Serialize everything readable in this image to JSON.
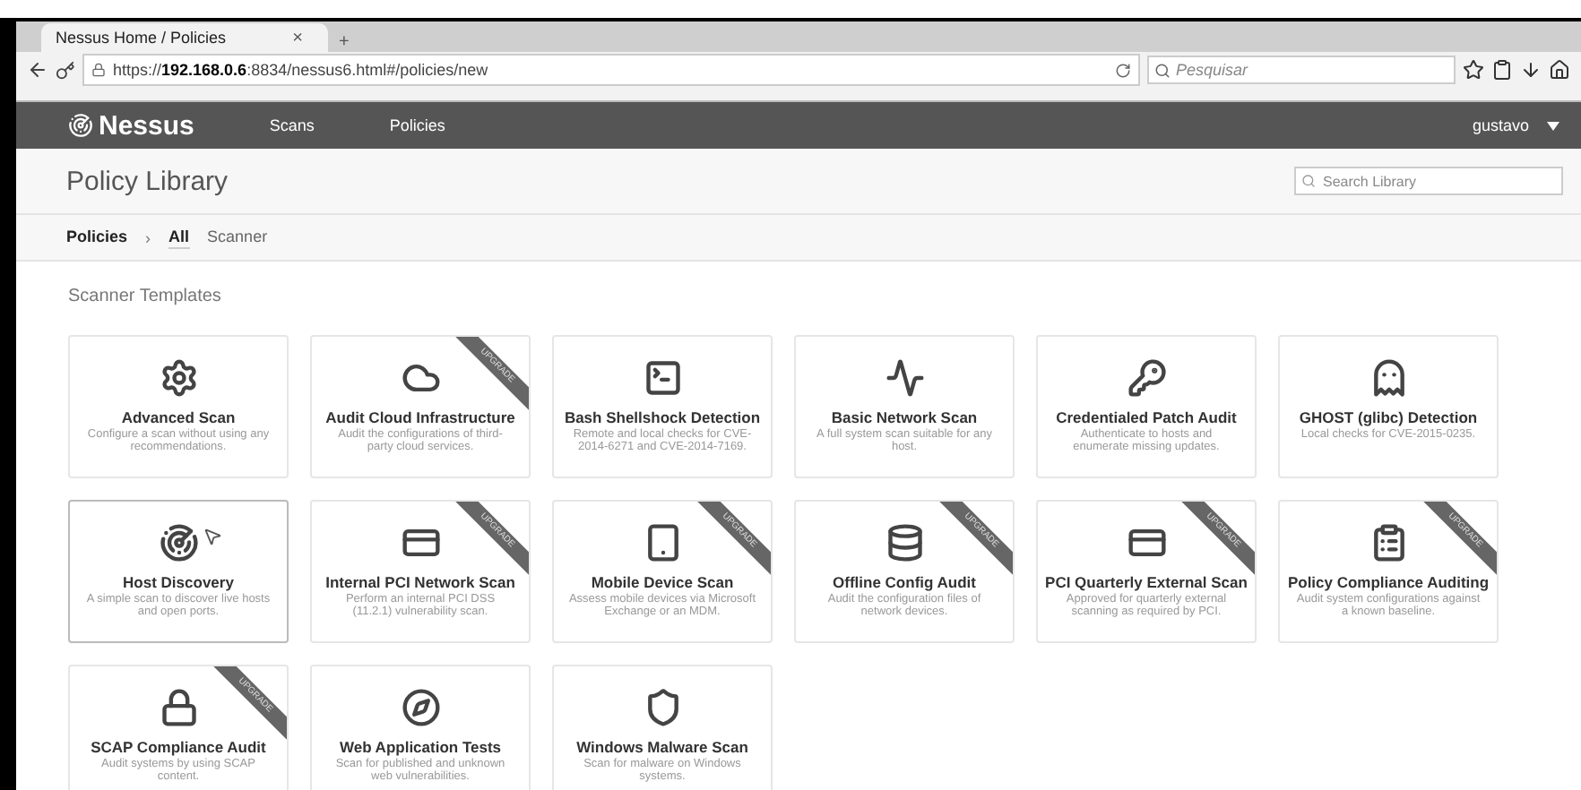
{
  "browser": {
    "tab": {
      "title": "Nessus Home / Policies",
      "close": "×",
      "new_tab": "+"
    },
    "url": "https://**192.168.0.6**:8834/nessus6.html#/policies/new",
    "search": {
      "placeholder": "Pesquisar"
    }
  },
  "nav": {
    "logo": "Nessus",
    "items": [
      {
        "label": "Scans"
      },
      {
        "label": "Policies"
      }
    ],
    "user": "gustavo"
  },
  "header": {
    "title": "Policy Library",
    "search": {
      "placeholder": "Search Library"
    }
  },
  "breadcrumb": {
    "items": [
      {
        "label": "Policies",
        "selected": false
      },
      {
        "label": "All",
        "selected": true
      },
      {
        "label": "Scanner",
        "selected": false
      }
    ],
    "separator": "›"
  },
  "section_title": "Scanner Templates",
  "templates": [
    {
      "title": "Advanced Scan",
      "description": "Configure a scan without using any recommendations."
    },
    {
      "title": "Audit Cloud Infrastructure",
      "description": "Audit the configurations of third-party cloud services.",
      "ribbon": "UPGRADE"
    },
    {
      "title": "Bash Shellshock Detection",
      "description": "Remote and local checks for CVE-2014-6271 and CVE-2014-7169."
    },
    {
      "title": "Basic Network Scan",
      "description": "A full system scan suitable for any host."
    },
    {
      "title": "Credentialed Patch Audit",
      "description": "Authenticate to hosts and enumerate missing updates."
    },
    {
      "title": "GHOST (glibc) Detection",
      "description": "Local checks for CVE-2015-0235."
    },
    {
      "title": "Host Discovery",
      "description": "A simple scan to discover live hosts and open ports.",
      "hovered": true
    },
    {
      "title": "Internal PCI Network Scan",
      "description": "Perform an internal PCI DSS (11.2.1) vulnerability scan.",
      "ribbon": "UPGRADE"
    },
    {
      "title": "Mobile Device Scan",
      "description": "Assess mobile devices via Microsoft Exchange or an MDM.",
      "ribbon": "UPGRADE"
    },
    {
      "title": "Offline Config Audit",
      "description": "Audit the configuration files of network devices.",
      "ribbon": "UPGRADE"
    },
    {
      "title": "PCI Quarterly External Scan",
      "description": "Approved for quarterly external scanning as required by PCI.",
      "ribbon": "UPGRADE"
    },
    {
      "title": "Policy Compliance Auditing",
      "description": "Audit system configurations against a known baseline.",
      "ribbon": "UPGRADE"
    },
    {
      "title": "SCAP Compliance Audit",
      "description": "Audit systems by using SCAP content.",
      "ribbon": "UPGRADE"
    },
    {
      "title": "Web Application Tests",
      "description": "Scan for published and unknown web vulnerabilities."
    },
    {
      "title": "Windows Malware Scan",
      "description": "Scan for malware on Windows systems."
    }
  ]
}
